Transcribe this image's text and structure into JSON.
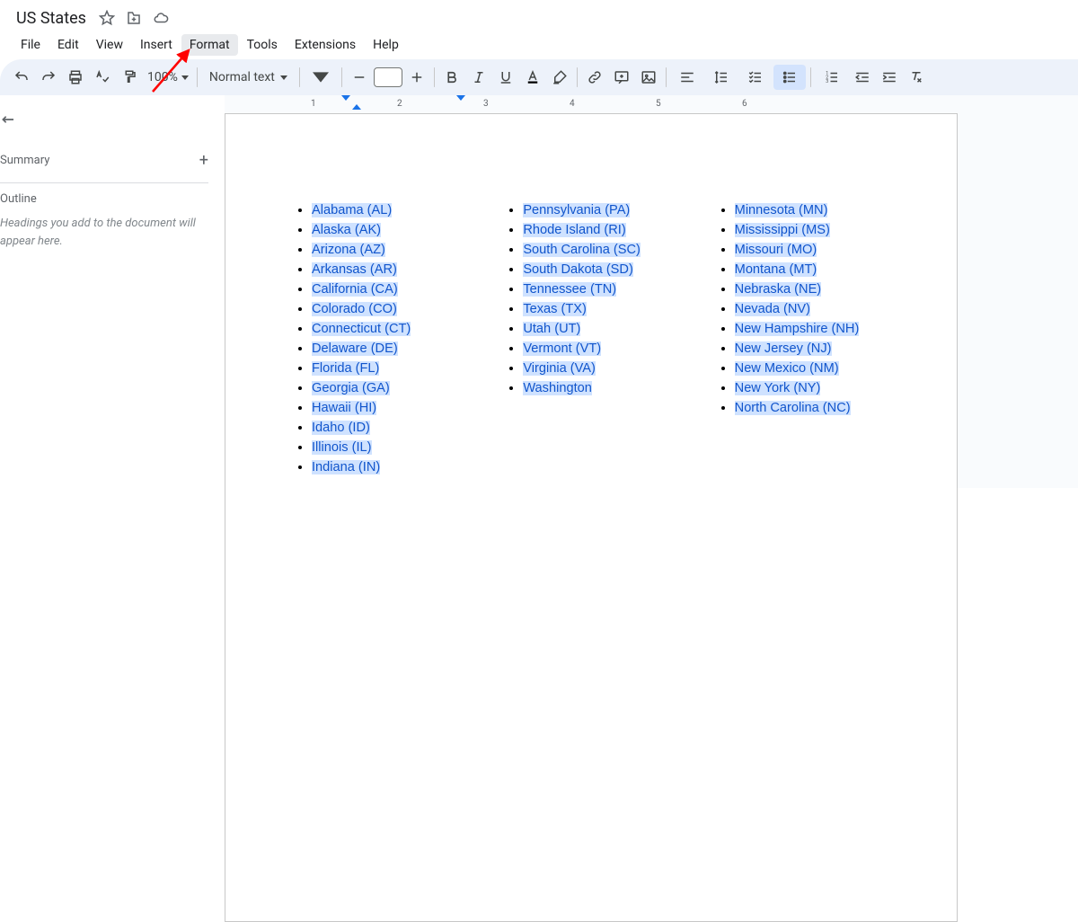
{
  "doc": {
    "title": "US States"
  },
  "menu": [
    "File",
    "Edit",
    "View",
    "Insert",
    "Format",
    "Tools",
    "Extensions",
    "Help"
  ],
  "menu_highlight": "Format",
  "toolbar": {
    "zoom": "100%",
    "style": "Normal text"
  },
  "ruler": {
    "marks": [
      1,
      2,
      3,
      4,
      5,
      6
    ]
  },
  "sidebar": {
    "summary": "Summary",
    "outline": "Outline",
    "hint": "Headings you add to the document will appear here."
  },
  "content": {
    "col1": [
      "Alabama (AL)",
      "Alaska (AK)",
      "Arizona (AZ)",
      "Arkansas (AR)",
      "California (CA)",
      "Colorado (CO)",
      "Connecticut (CT)",
      "Delaware (DE)",
      "Florida (FL)",
      "Georgia (GA)",
      "Hawaii (HI)",
      "Idaho (ID)",
      "Illinois (IL)",
      "Indiana (IN)"
    ],
    "col2": [
      "Pennsylvania (PA)",
      "Rhode Island (RI)",
      "South Carolina (SC)",
      "South Dakota (SD)",
      "Tennessee (TN)",
      "Texas (TX)",
      "Utah (UT)",
      "Vermont (VT)",
      "Virginia (VA)",
      "Washington"
    ],
    "col3": [
      "Minnesota (MN)",
      "Mississippi (MS)",
      "Missouri (MO)",
      "Montana (MT)",
      "Nebraska (NE)",
      "Nevada (NV)",
      "New Hampshire (NH)",
      "New Jersey (NJ)",
      "New Mexico (NM)",
      "New York (NY)",
      "North Carolina (NC)"
    ]
  }
}
